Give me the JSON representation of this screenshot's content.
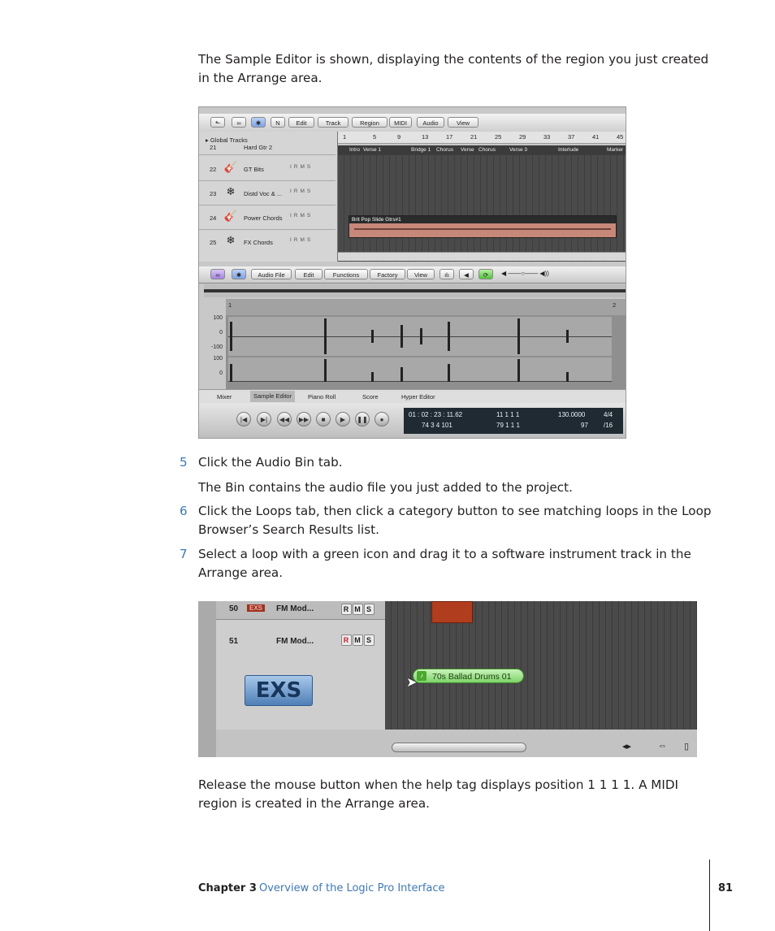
{
  "intro": "The Sample Editor is shown, displaying the contents of the region you just created in the Arrange area.",
  "steps": [
    {
      "num": "5",
      "text": "Click the Audio Bin tab."
    },
    {
      "num": "6",
      "text": "Click the Loops tab, then click a category button to see matching loops in the Loop Browser’s Search Results list."
    },
    {
      "num": "7",
      "text": "Select a loop with a green icon and drag it to a software instrument track in the Arrange area."
    }
  ],
  "step5_note": "The Bin contains the audio file you just added to the project.",
  "outro": "Release the mouse button when the help tag displays position 1 1 1 1. A MIDI region is created in the Arrange area.",
  "footer": {
    "chapter": "Chapter 3",
    "title": "Overview of the Logic Pro Interface",
    "page": "81"
  },
  "screenshot1": {
    "menus": [
      "Edit",
      "Track",
      "Region",
      "MIDI",
      "Audio",
      "View"
    ],
    "global_tracks": "Global Tracks",
    "tracks": [
      {
        "num": "21",
        "name": "Hard Gtr 2"
      },
      {
        "num": "22",
        "name": "GT Bits"
      },
      {
        "num": "23",
        "name": "Distd Voc & ..."
      },
      {
        "num": "24",
        "name": "Power Chords"
      },
      {
        "num": "25",
        "name": "FX Chords"
      }
    ],
    "ruler_numbers": [
      "1",
      "5",
      "9",
      "13",
      "17",
      "21",
      "25",
      "29",
      "33",
      "37",
      "41",
      "45"
    ],
    "markers": [
      "Intro",
      "Verse 1",
      "Bridge 1",
      "Chorus",
      "Verse",
      "Chorus",
      "Verse 3",
      "Interlude",
      "Marker"
    ],
    "region_name": "Brit Pop Slide Gtrs#1",
    "editor_menus": [
      "Audio File",
      "Edit",
      "Functions",
      "Factory",
      "View"
    ],
    "editor_ruler": [
      "1",
      "2"
    ],
    "amplitude_labels": [
      "100",
      "0",
      "-100",
      "100",
      "0"
    ],
    "tabs": [
      "Mixer",
      "Sample Editor",
      "Piano Roll",
      "Score",
      "Hyper Editor"
    ],
    "transport_buttons": [
      "|◀",
      "▶|",
      "◀◀",
      "▶▶",
      "■",
      "▶",
      "❚❚",
      "●"
    ],
    "lcd": {
      "smpte": "01 : 02 : 23 : 11.62",
      "bars": "74    3    4  101",
      "loc1": "11    1    1    1",
      "loc2": "79    1    1    1",
      "tempo": "130.0000",
      "sig": "4/4",
      "bpm2": "97",
      "div": "/16"
    }
  },
  "screenshot2": {
    "track50": {
      "num": "50",
      "tag": "EXS",
      "name": "FM Mod...",
      "rms": [
        "R",
        "M",
        "S"
      ]
    },
    "track51": {
      "num": "51",
      "name": "FM Mod...",
      "rms": [
        "R",
        "M",
        "S"
      ]
    },
    "exs_logo": "EXS",
    "loop_label": "70s Ballad Drums 01"
  }
}
